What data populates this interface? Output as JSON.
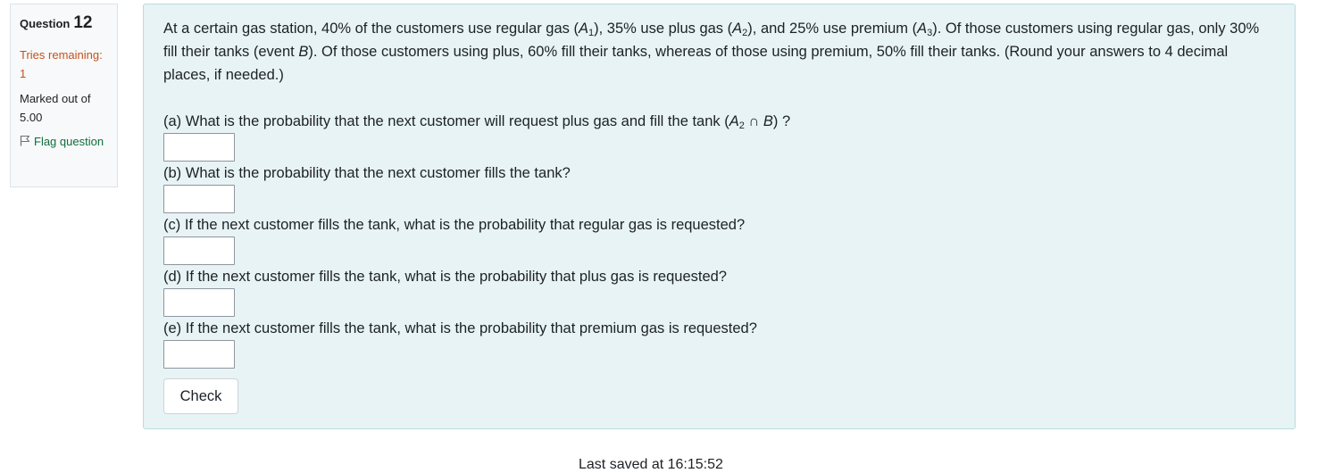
{
  "info": {
    "question_label": "Question",
    "question_number": "12",
    "tries_label": "Tries remaining:",
    "tries_value": "1",
    "marked_label": "Marked out of",
    "marked_value": "5.00",
    "flag_label": "Flag question"
  },
  "question": {
    "intro_1": "At a certain gas station, 40% of the customers use regular gas (",
    "A": "A",
    "sub1": "1",
    "intro_2": "), 35% use plus gas (",
    "sub2": "2",
    "intro_3": "), and 25% use premium (",
    "sub3": "3",
    "intro_4": "). Of those customers using regular gas, only 30% fill their tanks (event ",
    "B": "B",
    "intro_5": "). Of those customers using plus, 60% fill their tanks, whereas of those using premium, 50% fill their tanks. (Round your answers to 4 decimal places, if needed.)",
    "part_a_1": "(a) What is the probability that the next customer will request plus gas and fill the tank (",
    "part_a_cap": " ∩ ",
    "part_a_2": ") ?",
    "part_b": "(b) What is the probability that the next customer fills the tank?",
    "part_c": "(c) If the next customer fills the tank, what is the probability that regular gas is requested?",
    "part_d": "(d) If the next customer fills the tank, what is the probability that plus gas is requested?",
    "part_e": "(e) If the next customer fills the tank, what is the probability that premium gas is requested?",
    "answers": [
      "",
      "",
      "",
      "",
      ""
    ],
    "check_label": "Check"
  },
  "footer": {
    "saved_text": "Last saved at 16:15:52"
  }
}
